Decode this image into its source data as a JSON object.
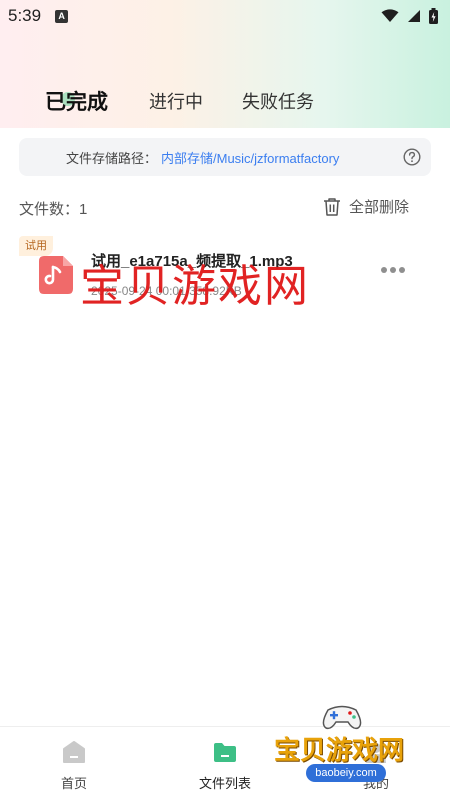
{
  "status_bar": {
    "time": "5:39",
    "badge_letter": "A"
  },
  "tabs": [
    {
      "label": "已完成",
      "active": true
    },
    {
      "label": "进行中",
      "active": false
    },
    {
      "label": "失败任务",
      "active": false
    }
  ],
  "storage": {
    "label": "文件存储路径：",
    "path": "内部存储/Music/jzformatfactory"
  },
  "file_count": {
    "label": "文件数：1"
  },
  "delete_all": {
    "label": "全部删除"
  },
  "files": [
    {
      "badge": "试用",
      "name": "试用_e1a715a_频提取_1.mp3",
      "meta": "2025-09-24 00:01  358.92KB"
    }
  ],
  "watermark": {
    "text": "宝贝游戏网",
    "logo_text": "宝贝游戏网",
    "logo_url": "baobeiy.com"
  },
  "bottom_nav": [
    {
      "label": "首页"
    },
    {
      "label": "文件列表"
    },
    {
      "label": "我的"
    }
  ],
  "colors": {
    "accent_green": "#3dbf86",
    "link_blue": "#3b7ef0",
    "music_red": "#f06a6a",
    "watermark_red": "#e01818"
  }
}
